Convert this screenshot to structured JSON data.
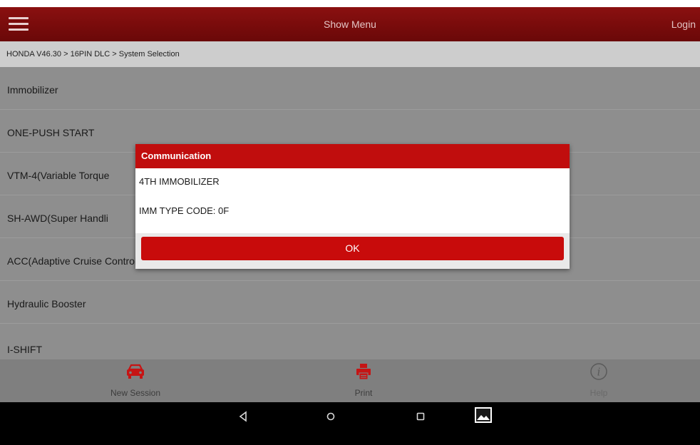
{
  "header": {
    "title": "Show Menu",
    "login_label": "Login"
  },
  "breadcrumb": "HONDA V46.30 > 16PIN DLC > System Selection",
  "list_items": [
    "Immobilizer",
    "ONE-PUSH START",
    "VTM-4(Variable Torque",
    "SH-AWD(Super Handli",
    "ACC(Adaptive Cruise Control)",
    "Hydraulic Booster",
    "I-SHIFT"
  ],
  "dialog": {
    "title": "Communication",
    "line1": "4TH IMMOBILIZER",
    "line2": "IMM TYPE CODE: 0F",
    "ok_label": "OK"
  },
  "bottom_bar": {
    "new_session_label": "New Session",
    "print_label": "Print",
    "help_label": "Help"
  },
  "colors": {
    "header_red": "#7a0c0c",
    "dialog_red": "#c00d0d",
    "icon_red": "#c61414",
    "dim_gray": "#8e8e8e"
  },
  "icons": [
    "menu-icon",
    "car-icon",
    "printer-icon",
    "help-icon",
    "back-icon",
    "home-icon",
    "recents-icon",
    "gallery-icon"
  ]
}
